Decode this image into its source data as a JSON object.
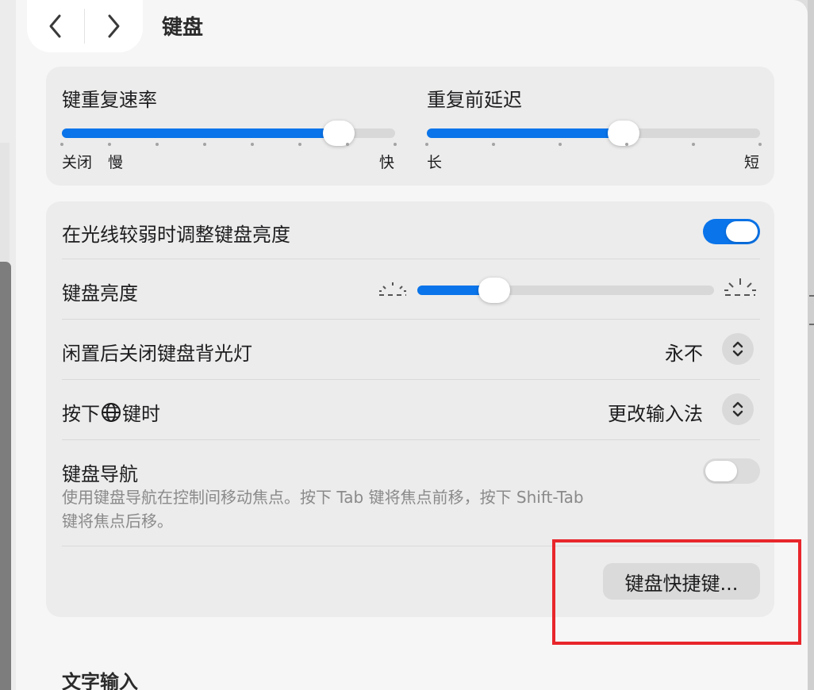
{
  "window": {
    "title": "键盘",
    "nav": {
      "back_icon": "chevron-left-icon",
      "forward_icon": "chevron-right-icon"
    }
  },
  "repeat": {
    "rate_label": "键重复速率",
    "rate_value": 0.83,
    "rate_ticks": [
      "关闭",
      "慢",
      "快"
    ],
    "delay_label": "重复前延迟",
    "delay_value": 0.59,
    "delay_ticks": [
      "长",
      "短"
    ]
  },
  "settings": {
    "auto_brightness": {
      "label": "在光线较弱时调整键盘亮度",
      "enabled": true
    },
    "brightness": {
      "label": "键盘亮度",
      "value": 0.26,
      "low_icon": "brightness-low-icon",
      "high_icon": "brightness-high-icon"
    },
    "backlight_off": {
      "label": "闲置后关闭键盘背光灯",
      "value": "永不",
      "icon": "updown-chevron-icon"
    },
    "globe_key": {
      "label_prefix": "按下",
      "label_suffix": "键时",
      "globe_icon": "globe-icon",
      "value": "更改输入法",
      "icon": "updown-chevron-icon"
    },
    "keyboard_nav": {
      "label": "键盘导航",
      "enabled": false,
      "description_line1": "使用键盘导航在控制间移动焦点。按下 Tab 键将焦点前移，按下 Shift-Tab",
      "description_line2": "键将焦点后移。"
    },
    "shortcuts_button": "键盘快捷键..."
  },
  "text_input": {
    "heading": "文字输入"
  },
  "colors": {
    "accent": "#0a74ea",
    "highlight": "#e8262b"
  }
}
